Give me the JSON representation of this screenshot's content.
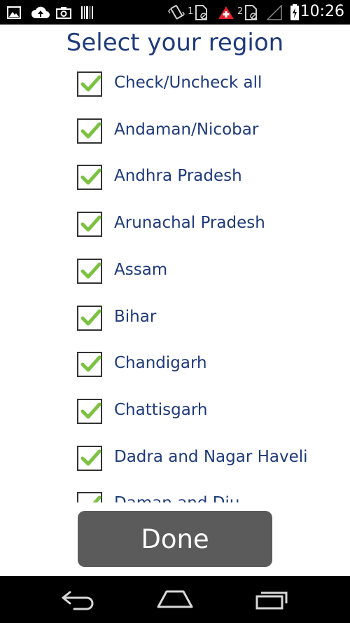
{
  "status_bar": {
    "time": "10:26",
    "sim1_label": "1",
    "sim2_label": "2",
    "icons": [
      "gallery-icon",
      "cloud-upload-icon",
      "camera-icon",
      "barcode-icon",
      "vibrate-icon",
      "sim1-icon",
      "swiss-flag-icon",
      "sim2-icon",
      "signal-icon",
      "battery-charging-icon"
    ]
  },
  "title": "Select your region",
  "regions": [
    {
      "label": "Check/Uncheck all",
      "checked": true
    },
    {
      "label": "Andaman/Nicobar",
      "checked": true
    },
    {
      "label": "Andhra Pradesh",
      "checked": true
    },
    {
      "label": "Arunachal Pradesh",
      "checked": true
    },
    {
      "label": "Assam",
      "checked": true
    },
    {
      "label": "Bihar",
      "checked": true
    },
    {
      "label": "Chandigarh",
      "checked": true
    },
    {
      "label": "Chattisgarh",
      "checked": true
    },
    {
      "label": "Dadra and Nagar Haveli",
      "checked": true
    },
    {
      "label": "Daman and Diu",
      "checked": true
    }
  ],
  "done_label": "Done",
  "nav_bar": {
    "icons": [
      "back-icon",
      "home-icon",
      "recent-apps-icon"
    ]
  },
  "colors": {
    "title": "#1e3a7b",
    "check": "#7cc242",
    "button": "#5b5b5b"
  }
}
